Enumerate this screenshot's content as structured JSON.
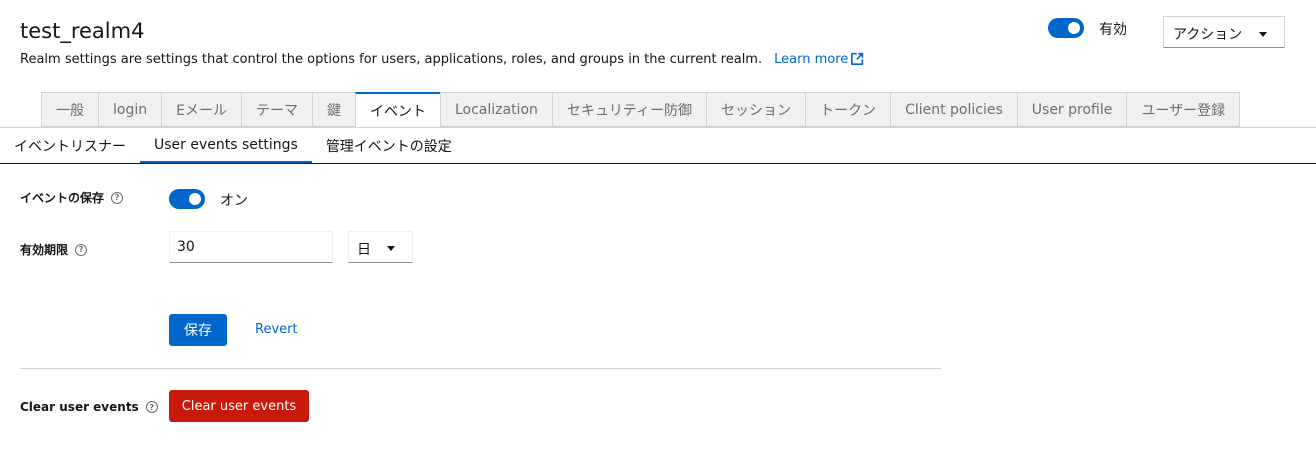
{
  "header": {
    "title": "test_realm4",
    "subtitle": "Realm settings are settings that control the options for users, applications, roles, and groups in the current realm.",
    "learn_more": "Learn more",
    "enabled_label": "有効",
    "enabled": true,
    "action_label": "アクション"
  },
  "tabs": [
    {
      "label": "一般",
      "active": false
    },
    {
      "label": "login",
      "active": false
    },
    {
      "label": "Eメール",
      "active": false
    },
    {
      "label": "テーマ",
      "active": false
    },
    {
      "label": "鍵",
      "active": false
    },
    {
      "label": "イベント",
      "active": true
    },
    {
      "label": "Localization",
      "active": false
    },
    {
      "label": "セキュリティー防御",
      "active": false
    },
    {
      "label": "セッション",
      "active": false
    },
    {
      "label": "トークン",
      "active": false
    },
    {
      "label": "Client policies",
      "active": false
    },
    {
      "label": "User profile",
      "active": false
    },
    {
      "label": "ユーザー登録",
      "active": false
    }
  ],
  "subtabs": [
    {
      "label": "イベントリスナー",
      "active": false
    },
    {
      "label": "User events settings",
      "active": true
    },
    {
      "label": "管理イベントの設定",
      "active": false
    }
  ],
  "form": {
    "save_events_label": "イベントの保存",
    "save_events_toggle_label": "オン",
    "save_events_on": true,
    "expiration_label": "有効期限",
    "expiration_value": "30",
    "expiration_unit": "日",
    "save_button": "保存",
    "revert_button": "Revert",
    "clear_label": "Clear user events",
    "clear_button": "Clear user events"
  },
  "colors": {
    "accent": "#0066cc",
    "danger": "#c9190b"
  }
}
